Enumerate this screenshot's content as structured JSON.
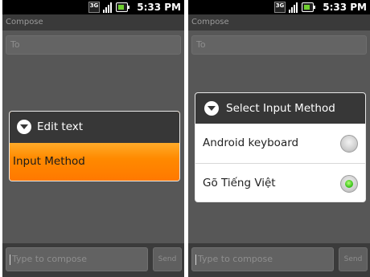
{
  "left": {
    "status": {
      "time": "5:33 PM",
      "network_badge": "3G"
    },
    "window_title": "Compose",
    "to_placeholder": "To",
    "compose_placeholder": "Type to compose",
    "send_label": "Send",
    "dialog": {
      "title": "Edit text",
      "icon": "chevron-down-circle-icon",
      "options": [
        "Input Method"
      ],
      "selected_color": "#ff8a00"
    }
  },
  "right": {
    "status": {
      "time": "5:33 PM",
      "network_badge": "3G"
    },
    "window_title": "Compose",
    "to_placeholder": "To",
    "compose_placeholder": "Type to compose",
    "send_label": "Send",
    "dialog": {
      "title": "Select Input Method",
      "icon": "chevron-down-circle-icon",
      "choices": [
        {
          "label": "Android keyboard",
          "selected": false
        },
        {
          "label": "Gõ Tiếng Việt",
          "selected": true
        }
      ],
      "selected_color": "#3ec61e"
    }
  }
}
